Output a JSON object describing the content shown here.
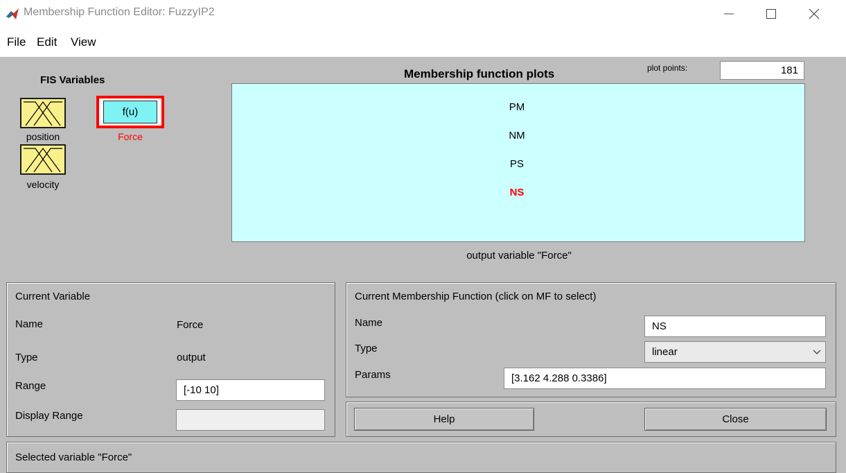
{
  "window": {
    "title": "Membership Function Editor: FuzzyIP2",
    "minimize_icon": "minimize-icon",
    "maximize_icon": "maximize-icon",
    "close_icon": "close-icon"
  },
  "menu": {
    "items": [
      "File",
      "Edit",
      "View"
    ]
  },
  "fis_variables": {
    "heading": "FIS Variables",
    "inputs": [
      "position",
      "velocity"
    ],
    "output": {
      "label": "Force",
      "box_text": "f(u)"
    }
  },
  "plot": {
    "title": "Membership function plots",
    "plot_points_label": "plot points:",
    "plot_points_value": "181",
    "mf_labels": [
      "PM",
      "NM",
      "PS",
      "NS"
    ],
    "selected_mf": "NS",
    "caption": "output variable \"Force\""
  },
  "current_variable": {
    "heading": "Current Variable",
    "name_label": "Name",
    "name_value": "Force",
    "type_label": "Type",
    "type_value": "output",
    "range_label": "Range",
    "range_value": "[-10 10]",
    "display_range_label": "Display Range",
    "display_range_value": ""
  },
  "current_mf": {
    "heading": "Current Membership Function (click on MF to select)",
    "name_label": "Name",
    "name_value": "NS",
    "type_label": "Type",
    "type_value": "linear",
    "params_label": "Params",
    "params_value": "[3.162 4.288 0.3386]"
  },
  "buttons": {
    "help": "Help",
    "close": "Close"
  },
  "status": "Selected variable \"Force\"",
  "colors": {
    "panel_bg": "#bebebe",
    "plot_bg": "#ccffff",
    "mf_icon": "#f9f08c",
    "output_icon": "#7ff3f4",
    "selected_red": "#ff0000"
  }
}
